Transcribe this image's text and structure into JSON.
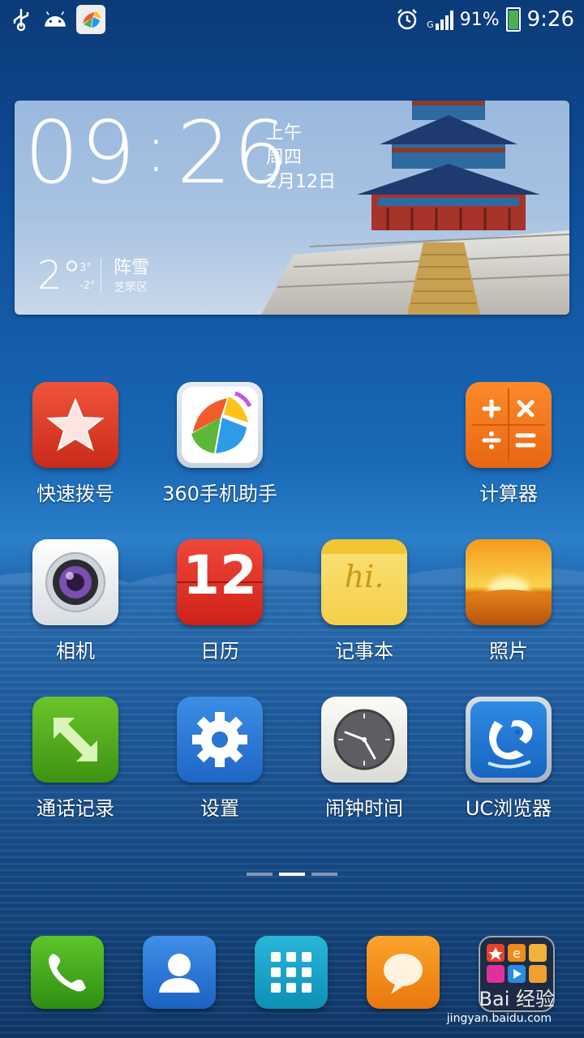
{
  "status_bar": {
    "battery": "91%",
    "time": "9:26",
    "network": "G",
    "icons": [
      "usb-icon",
      "android-icon",
      "app360-icon",
      "alarm-icon",
      "signal-icon",
      "battery-icon"
    ]
  },
  "widget": {
    "clock_hours": "09",
    "clock_sep": ":",
    "clock_minutes": "26",
    "ampm": "上午",
    "weekday": "周四",
    "date": "2月12日",
    "temp": "2°",
    "high": "3°",
    "low": "-2°",
    "condition": "阵雪",
    "city": "芝罘区"
  },
  "apps": [
    {
      "label": "快速拨号",
      "icon": "star-icon"
    },
    {
      "label": "360手机助手",
      "icon": "app360-icon"
    },
    {
      "label": "计算器",
      "icon": "calculator-icon"
    },
    {
      "label": "相机",
      "icon": "camera-icon"
    },
    {
      "label": "日历",
      "icon": "calendar-icon",
      "day": "12"
    },
    {
      "label": "记事本",
      "icon": "notepad-icon",
      "note": "hi."
    },
    {
      "label": "照片",
      "icon": "photos-icon"
    },
    {
      "label": "通话记录",
      "icon": "call-log-icon"
    },
    {
      "label": "设置",
      "icon": "gear-icon"
    },
    {
      "label": "闹钟时间",
      "icon": "clock-icon"
    },
    {
      "label": "UC浏览器",
      "icon": "uc-browser-icon"
    }
  ],
  "page_indicator": {
    "count": 3,
    "active": 2
  },
  "dock": [
    "phone-icon",
    "contacts-icon",
    "app-drawer-icon",
    "messages-icon",
    "folder-icon"
  ],
  "watermark": {
    "brand": "Bai 经验",
    "url": "jingyan.baidu.com"
  }
}
